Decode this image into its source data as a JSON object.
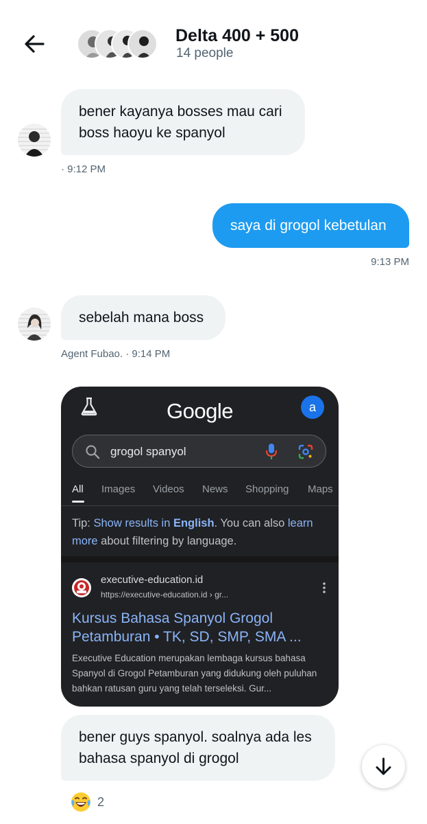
{
  "header": {
    "title": "Delta 400 + 500",
    "subtitle": "14 people",
    "back_icon": "arrow-left-icon"
  },
  "messages": [
    {
      "direction": "incoming",
      "text_lines": [
        "bener kayanya bosses mau cari",
        "boss haoyu ke spanyol"
      ],
      "meta": "· 9:12 PM"
    },
    {
      "direction": "outgoing",
      "text": "saya di grogol kebetulan",
      "meta": "9:13 PM"
    },
    {
      "direction": "incoming",
      "text": "sebelah mana boss",
      "meta": "Agent Fubao. · 9:14 PM"
    },
    {
      "direction": "incoming",
      "type": "image",
      "screenshot": {
        "logo": "Google",
        "account_initial": "a",
        "search_query": "grogol spanyol",
        "tabs": [
          "All",
          "Images",
          "Videos",
          "News",
          "Shopping",
          "Maps"
        ],
        "active_tab": "All",
        "tip": {
          "prefix": "Tip: ",
          "link1": "Show results in ",
          "link1_bold": "English",
          "middle": ". You can also ",
          "link2": "learn more",
          "suffix": " about filtering by language."
        },
        "result": {
          "site_name": "executive-education.id",
          "url": "https://executive-education.id › gr...",
          "title": " Kursus Bahasa Spanyol Grogol Petamburan • TK, SD, SMP, SMA ...",
          "snippet": "Executive Education merupakan lembaga kursus bahasa Spanyol di Grogol Petamburan yang didukung oleh puluhan bahkan ratusan guru yang telah terseleksi. Gur..."
        }
      }
    },
    {
      "direction": "incoming",
      "text_lines": [
        "bener guys spanyol. soalnya ada les",
        "bahasa spanyol di grogol"
      ],
      "reaction": {
        "emoji": "😂",
        "count": "2"
      }
    }
  ],
  "scroll_button_icon": "arrow-down-icon",
  "colors": {
    "outgoing_bubble": "#1d9bf0",
    "incoming_bubble": "#eff3f4",
    "meta_text": "#536471",
    "google_dark_bg": "#202124",
    "google_link": "#8ab4f8"
  }
}
